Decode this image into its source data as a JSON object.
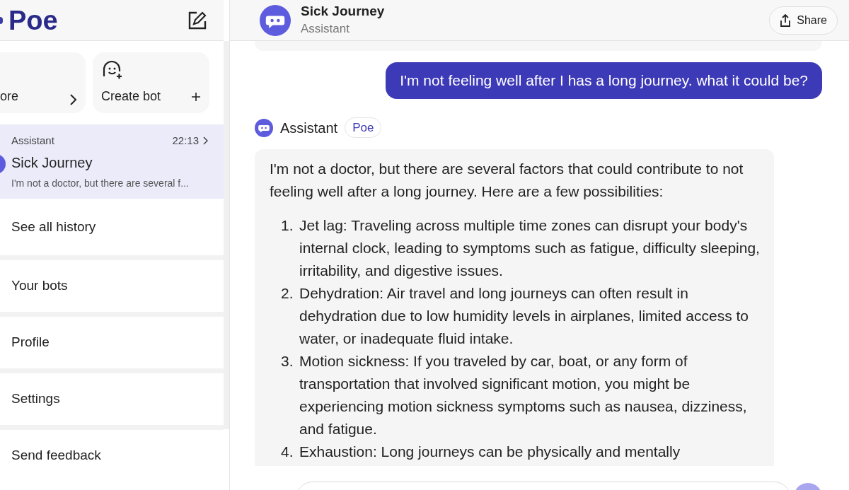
{
  "sidebar": {
    "logo": "Poe",
    "cards": [
      {
        "kind": "explore",
        "label": "ore"
      },
      {
        "kind": "create",
        "label": "Create bot"
      }
    ],
    "chats": [
      {
        "bot": "Assistant",
        "time": "22:13",
        "title": "Sick Journey",
        "preview": "I'm not a doctor, but there are several f...",
        "selected": true
      }
    ],
    "menu": [
      "See all history",
      "Your bots",
      "Profile",
      "Settings",
      "Send feedback"
    ]
  },
  "header": {
    "title": "Sick Journey",
    "subtitle": "Assistant",
    "share": "Share"
  },
  "messages": [
    {
      "kind": "user",
      "text": "I'm not feeling well after I has a long journey. what it could be?"
    },
    {
      "kind": "bot",
      "name": "Assistant",
      "tag": "Poe",
      "intro": "I'm not a doctor, but there are several factors that could contribute to not feeling well after a long journey. Here are a few possibilities:",
      "items": [
        {
          "number": "1.",
          "text": "Jet lag: Traveling across multiple time zones can disrupt your body's internal clock, leading to symptoms such as fatigue, difficulty sleeping, irritability, and digestive issues."
        },
        {
          "number": "2.",
          "text": "Dehydration: Air travel and long journeys can often result in dehydration due to low humidity levels in airplanes, limited access to water, or inadequate fluid intake."
        },
        {
          "number": "3.",
          "text": "Motion sickness: If you traveled by car, boat, or any form of transportation that involved significant motion, you might be experiencing motion sickness symptoms such as nausea, dizziness, and fatigue."
        },
        {
          "number": "4.",
          "text": "Exhaustion: Long journeys can be physically and mentally"
        }
      ]
    }
  ]
}
